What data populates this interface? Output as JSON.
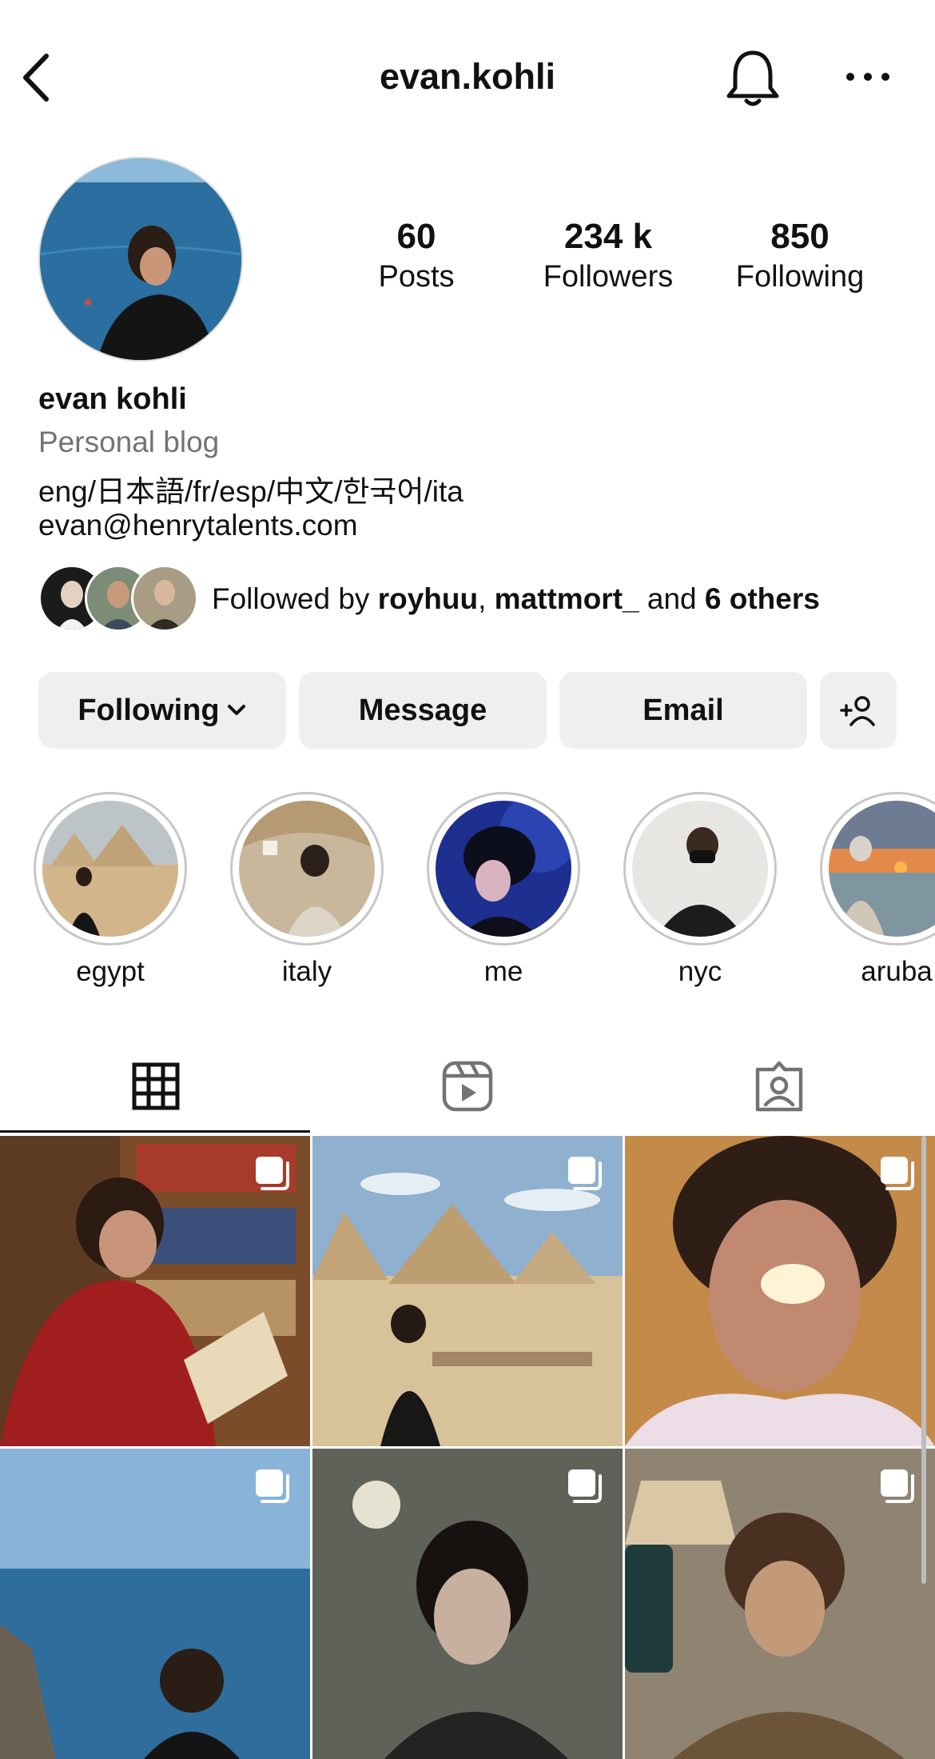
{
  "header": {
    "username": "evan.kohli",
    "back_icon": "chevron-left-icon",
    "bell_icon": "bell-icon",
    "more_icon": "more-horizontal-icon"
  },
  "stats": [
    {
      "value": "60",
      "label": "Posts"
    },
    {
      "value": "234 k",
      "label": "Followers"
    },
    {
      "value": "850",
      "label": "Following"
    }
  ],
  "bio": {
    "name": "evan kohli",
    "category": "Personal blog",
    "languages": "eng/日本語/fr/esp/中文/한국어/ita",
    "email": "evan@henrytalents.com"
  },
  "followed_by": {
    "prefix": "Followed by",
    "user1": "royhuu",
    "comma": ",",
    "user2": "mattmort_",
    "and": "and",
    "others": "6 others"
  },
  "actions": {
    "following_label": "Following",
    "message_label": "Message",
    "email_label": "Email",
    "add_user_icon": "add-user-icon"
  },
  "highlights": [
    {
      "label": "egypt"
    },
    {
      "label": "italy"
    },
    {
      "label": "me"
    },
    {
      "label": "nyc"
    },
    {
      "label": "aruba"
    }
  ],
  "tabs": [
    {
      "icon": "grid-icon",
      "selected": true
    },
    {
      "icon": "reels-icon",
      "selected": false
    },
    {
      "icon": "tagged-icon",
      "selected": false
    }
  ],
  "colors": {
    "button_bg": "#efefef",
    "secondary_text": "#737373",
    "ring": "#c7c7c7"
  }
}
